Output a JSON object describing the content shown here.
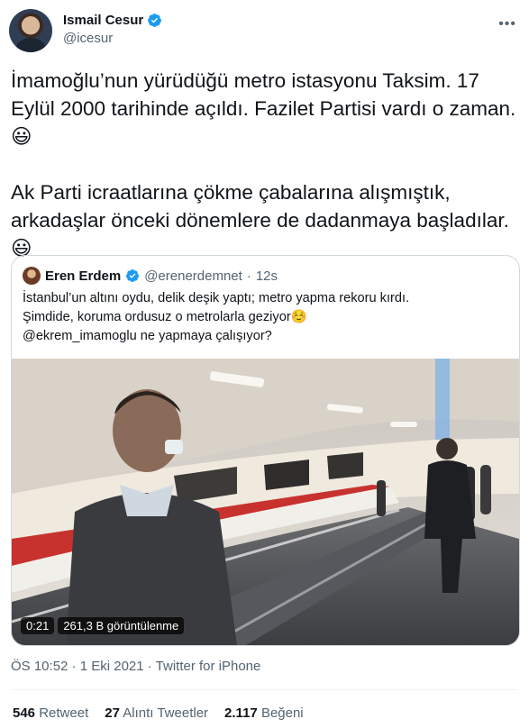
{
  "author": {
    "name": "Ismail Cesur",
    "handle": "@icesur",
    "verified": true,
    "more_icon": "ellipsis-icon"
  },
  "tweet": {
    "text": "İmamoğlu’nun yürüdüğü metro istasyonu Taksim. 17 Eylül 2000 tarihinde açıldı. Fazilet Partisi vardı o zaman. 😃\n\nAk Parti icraatlarına çökme çabalarına alışmıştık, arkadaşlar önceki dönemlere de dadanmaya başladılar. 😃"
  },
  "quoted": {
    "name": "Eren Erdem",
    "handle": "@erenerdemnet",
    "separator": "·",
    "time": "12s",
    "text": "İstanbul’un altını oydu, delik deşik yaptı; metro yapma rekoru kırdı.\nŞimdide, koruma ordusuz o metrolarla geziyor☺️\n@ekrem_imamoglu ne yapmaya çalışıyor?",
    "video": {
      "duration": "0:21",
      "views": "261,3 B görüntülenme"
    }
  },
  "meta": {
    "text": "ÖS 10:52 · 1 Eki 2021 · Twitter for iPhone"
  },
  "stats": {
    "retweets_count": "546",
    "retweets_label": "Retweet",
    "quotes_count": "27",
    "quotes_label": "Alıntı Tweetler",
    "likes_count": "2.117",
    "likes_label": "Beğeni"
  },
  "colors": {
    "verified": "#1d9bf0",
    "secondary_text": "#536471",
    "primary_text": "#0f1419",
    "border": "#cfd9de"
  }
}
